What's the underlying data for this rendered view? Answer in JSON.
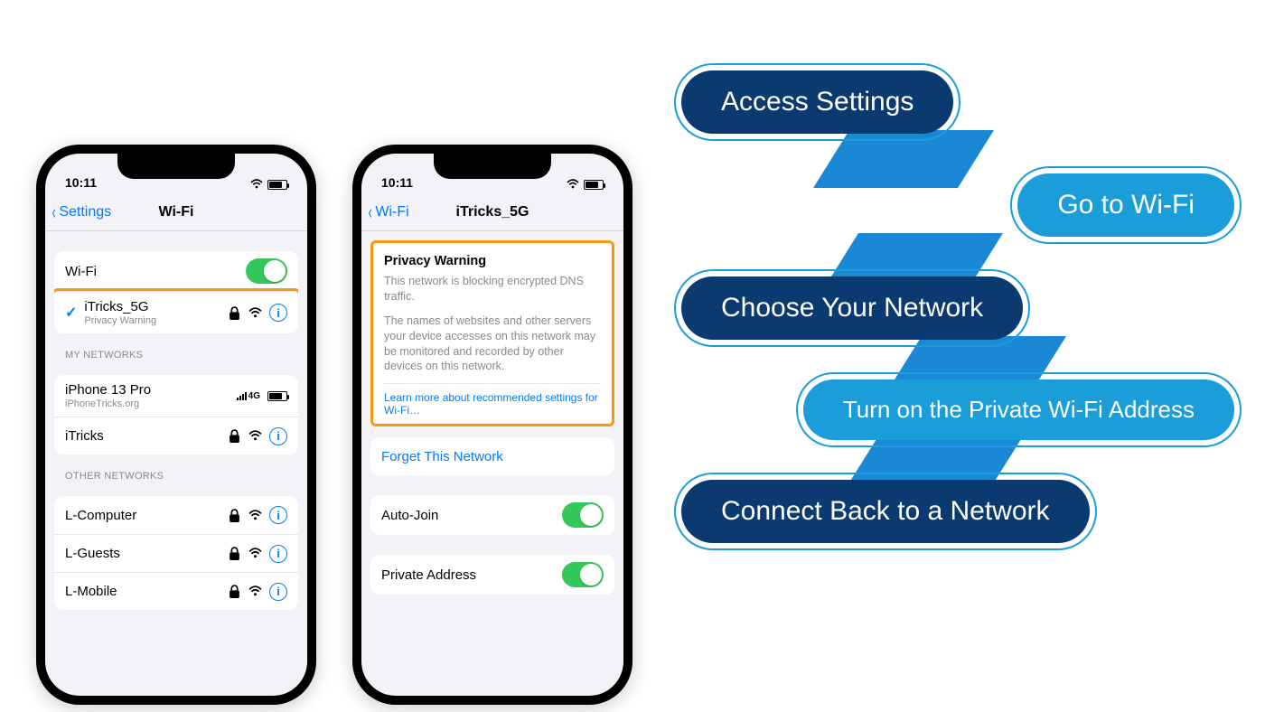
{
  "phone_a": {
    "time": "10:11",
    "back": "Settings",
    "title": "Wi-Fi",
    "wifi_row_label": "Wi-Fi",
    "connected": {
      "name": "iTricks_5G",
      "sub": "Privacy Warning"
    },
    "my_networks_hdr": "MY NETWORKS",
    "my_networks": [
      {
        "name": "iPhone 13 Pro",
        "sub": "iPhoneTricks.org",
        "cell": "4G"
      },
      {
        "name": "iTricks"
      }
    ],
    "other_hdr": "OTHER NETWORKS",
    "other": [
      {
        "name": "L-Computer"
      },
      {
        "name": "L-Guests"
      },
      {
        "name": "L-Mobile"
      }
    ]
  },
  "phone_b": {
    "time": "10:11",
    "back": "Wi-Fi",
    "title": "iTricks_5G",
    "warning": {
      "heading": "Privacy Warning",
      "p1": "This network is blocking encrypted DNS traffic.",
      "p2": "The names of websites and other servers your device accesses on this network may be monitored and recorded by other devices on this network.",
      "link": "Learn more about recommended settings for Wi-Fi…"
    },
    "forget": "Forget This Network",
    "auto_join": "Auto-Join",
    "private_addr": "Private Address"
  },
  "steps": [
    "Access Settings",
    "Go to Wi-Fi",
    "Choose Your Network",
    "Turn on the Private Wi-Fi Address",
    "Connect Back to a Network"
  ]
}
